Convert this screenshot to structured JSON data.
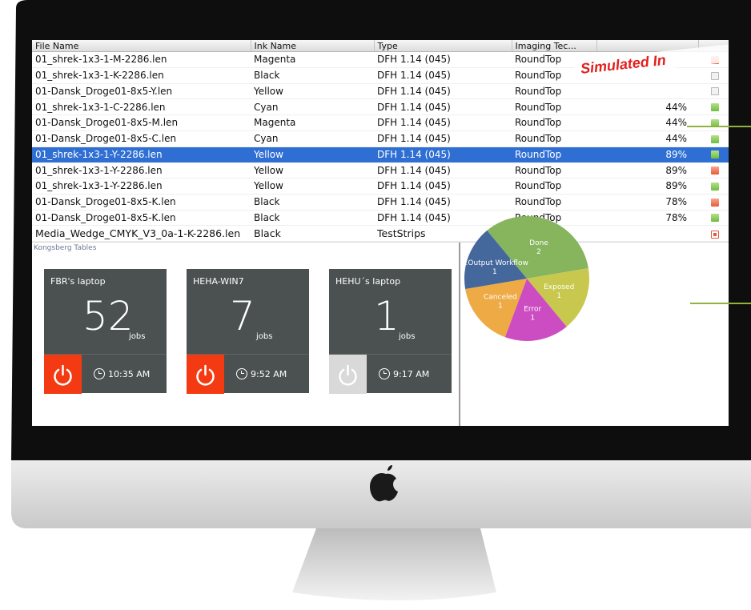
{
  "overlay": {
    "banner": "Simulated In"
  },
  "table": {
    "columns": [
      "File Name",
      "Ink Name",
      "Type",
      "Imaging Tec...",
      "",
      ""
    ],
    "rows": [
      {
        "file": "01_shrek-1x3-1-M-2286.len",
        "ink": "Magenta",
        "type": "DFH 1.14 (045)",
        "imaging": "RoundTop",
        "pct": "",
        "status": "err"
      },
      {
        "file": "01_shrek-1x3-1-K-2286.len",
        "ink": "Black",
        "type": "DFH 1.14 (045)",
        "imaging": "RoundTop",
        "pct": "",
        "status": "idle"
      },
      {
        "file": "01-Dansk_Droge01-8x5-Y.len",
        "ink": "Yellow",
        "type": "DFH 1.14 (045)",
        "imaging": "RoundTop",
        "pct": "",
        "status": "idle"
      },
      {
        "file": "01_shrek-1x3-1-C-2286.len",
        "ink": "Cyan",
        "type": "DFH 1.14 (045)",
        "imaging": "RoundTop",
        "pct": "44%",
        "status": "ok"
      },
      {
        "file": "01-Dansk_Droge01-8x5-M.len",
        "ink": "Magenta",
        "type": "DFH 1.14 (045)",
        "imaging": "RoundTop",
        "pct": "44%",
        "status": "ok"
      },
      {
        "file": "01-Dansk_Droge01-8x5-C.len",
        "ink": "Cyan",
        "type": "DFH 1.14 (045)",
        "imaging": "RoundTop",
        "pct": "44%",
        "status": "ok"
      },
      {
        "file": "01_shrek-1x3-1-Y-2286.len",
        "ink": "Yellow",
        "type": "DFH 1.14 (045)",
        "imaging": "RoundTop",
        "pct": "89%",
        "status": "ok",
        "selected": true
      },
      {
        "file": "01_shrek-1x3-1-Y-2286.len",
        "ink": "Yellow",
        "type": "DFH 1.14 (045)",
        "imaging": "RoundTop",
        "pct": "89%",
        "status": "err"
      },
      {
        "file": "01_shrek-1x3-1-Y-2286.len",
        "ink": "Yellow",
        "type": "DFH 1.14 (045)",
        "imaging": "RoundTop",
        "pct": "89%",
        "status": "ok"
      },
      {
        "file": "01-Dansk_Droge01-8x5-K.len",
        "ink": "Black",
        "type": "DFH 1.14 (045)",
        "imaging": "RoundTop",
        "pct": "78%",
        "status": "err"
      },
      {
        "file": "01-Dansk_Droge01-8x5-K.len",
        "ink": "Black",
        "type": "DFH 1.14 (045)",
        "imaging": "RoundTop",
        "pct": "78%",
        "status": "ok"
      },
      {
        "file": "Media_Wedge_CMYK_V3_0a-1-K-2286.len",
        "ink": "Black",
        "type": "TestStrips",
        "imaging": "",
        "pct": "",
        "status": "strip"
      }
    ]
  },
  "dashboard": {
    "section_label": "Kongsberg Tables",
    "tiles": [
      {
        "name": "FBR's laptop",
        "count": "52",
        "unit": "jobs",
        "time": "10:35 AM",
        "power_on": true
      },
      {
        "name": "HEHA-WIN7",
        "count": "7",
        "unit": "jobs",
        "time": "9:52 AM",
        "power_on": true
      },
      {
        "name": "HEHU´s laptop",
        "count": "1",
        "unit": "jobs",
        "time": "9:17 AM",
        "power_on": false
      }
    ]
  },
  "chart_data": {
    "type": "pie",
    "slices": [
      {
        "label": "Done",
        "value": 2,
        "color": "#86b55e"
      },
      {
        "label": "Exposed",
        "value": 1,
        "color": "#c7c84d"
      },
      {
        "label": "Error",
        "value": 1,
        "color": "#cc4dc1"
      },
      {
        "label": "Canceled",
        "value": 1,
        "color": "#eeaa45"
      },
      {
        "label": "Output Workflow",
        "value": 1,
        "color": "#44679c"
      }
    ],
    "display_labels": {
      "Output Workflow": "...Output Workflow"
    }
  },
  "colors": {
    "selection": "#2f6fd3",
    "tile": "#4b5050",
    "power_active": "#f43a12",
    "marker_green": "#8fb33d"
  }
}
